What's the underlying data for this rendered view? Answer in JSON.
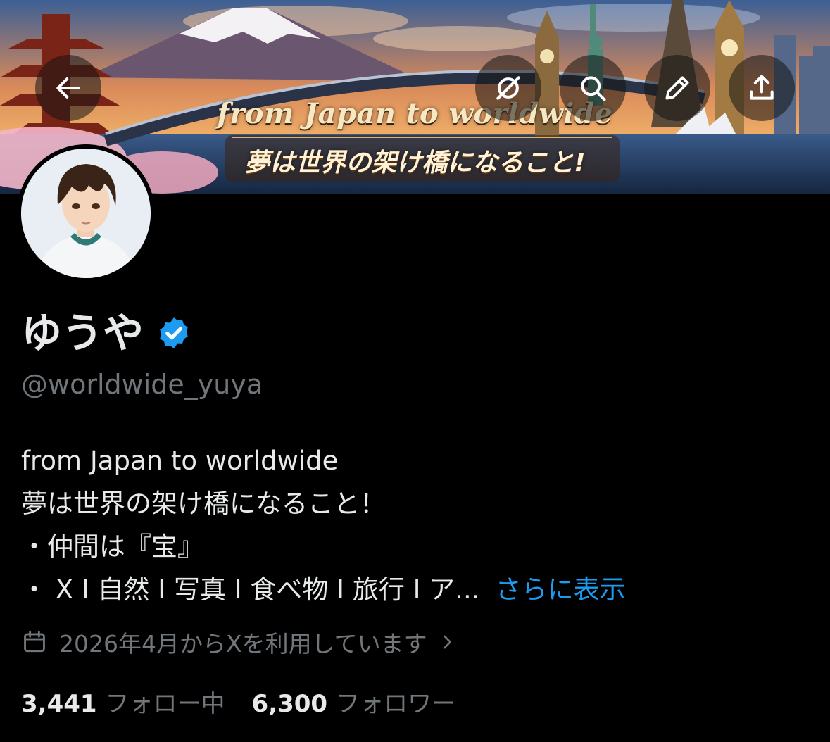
{
  "banner": {
    "line1": "from Japan to worldwide",
    "line2": "夢は世界の架け橋になること!"
  },
  "toolbar": {
    "back_icon": "arrow-left-icon",
    "grok_icon": "slashed-circle-icon",
    "search_icon": "search-icon",
    "edit_icon": "pencil-icon",
    "share_icon": "share-icon"
  },
  "profile": {
    "display_name": "ゆうや",
    "verified": true,
    "handle": "@worldwide_yuya",
    "bio": {
      "line1": "from Japan to worldwide",
      "line2": "夢は世界の架け橋になること！",
      "line3": "・仲間は『宝』",
      "line4": "・ X I 自然 I 写真 I 食べ物 I 旅行 I ア...",
      "show_more": "さらに表示"
    },
    "joined": "2026年4月からXを利用しています",
    "following_count": "3,441",
    "following_label": "フォロー中",
    "followers_count": "6,300",
    "followers_label": "フォロワー"
  },
  "colors": {
    "background": "#000000",
    "primary_text": "#e7e9ea",
    "secondary_text": "#71767b",
    "accent": "#1d9bf0"
  }
}
